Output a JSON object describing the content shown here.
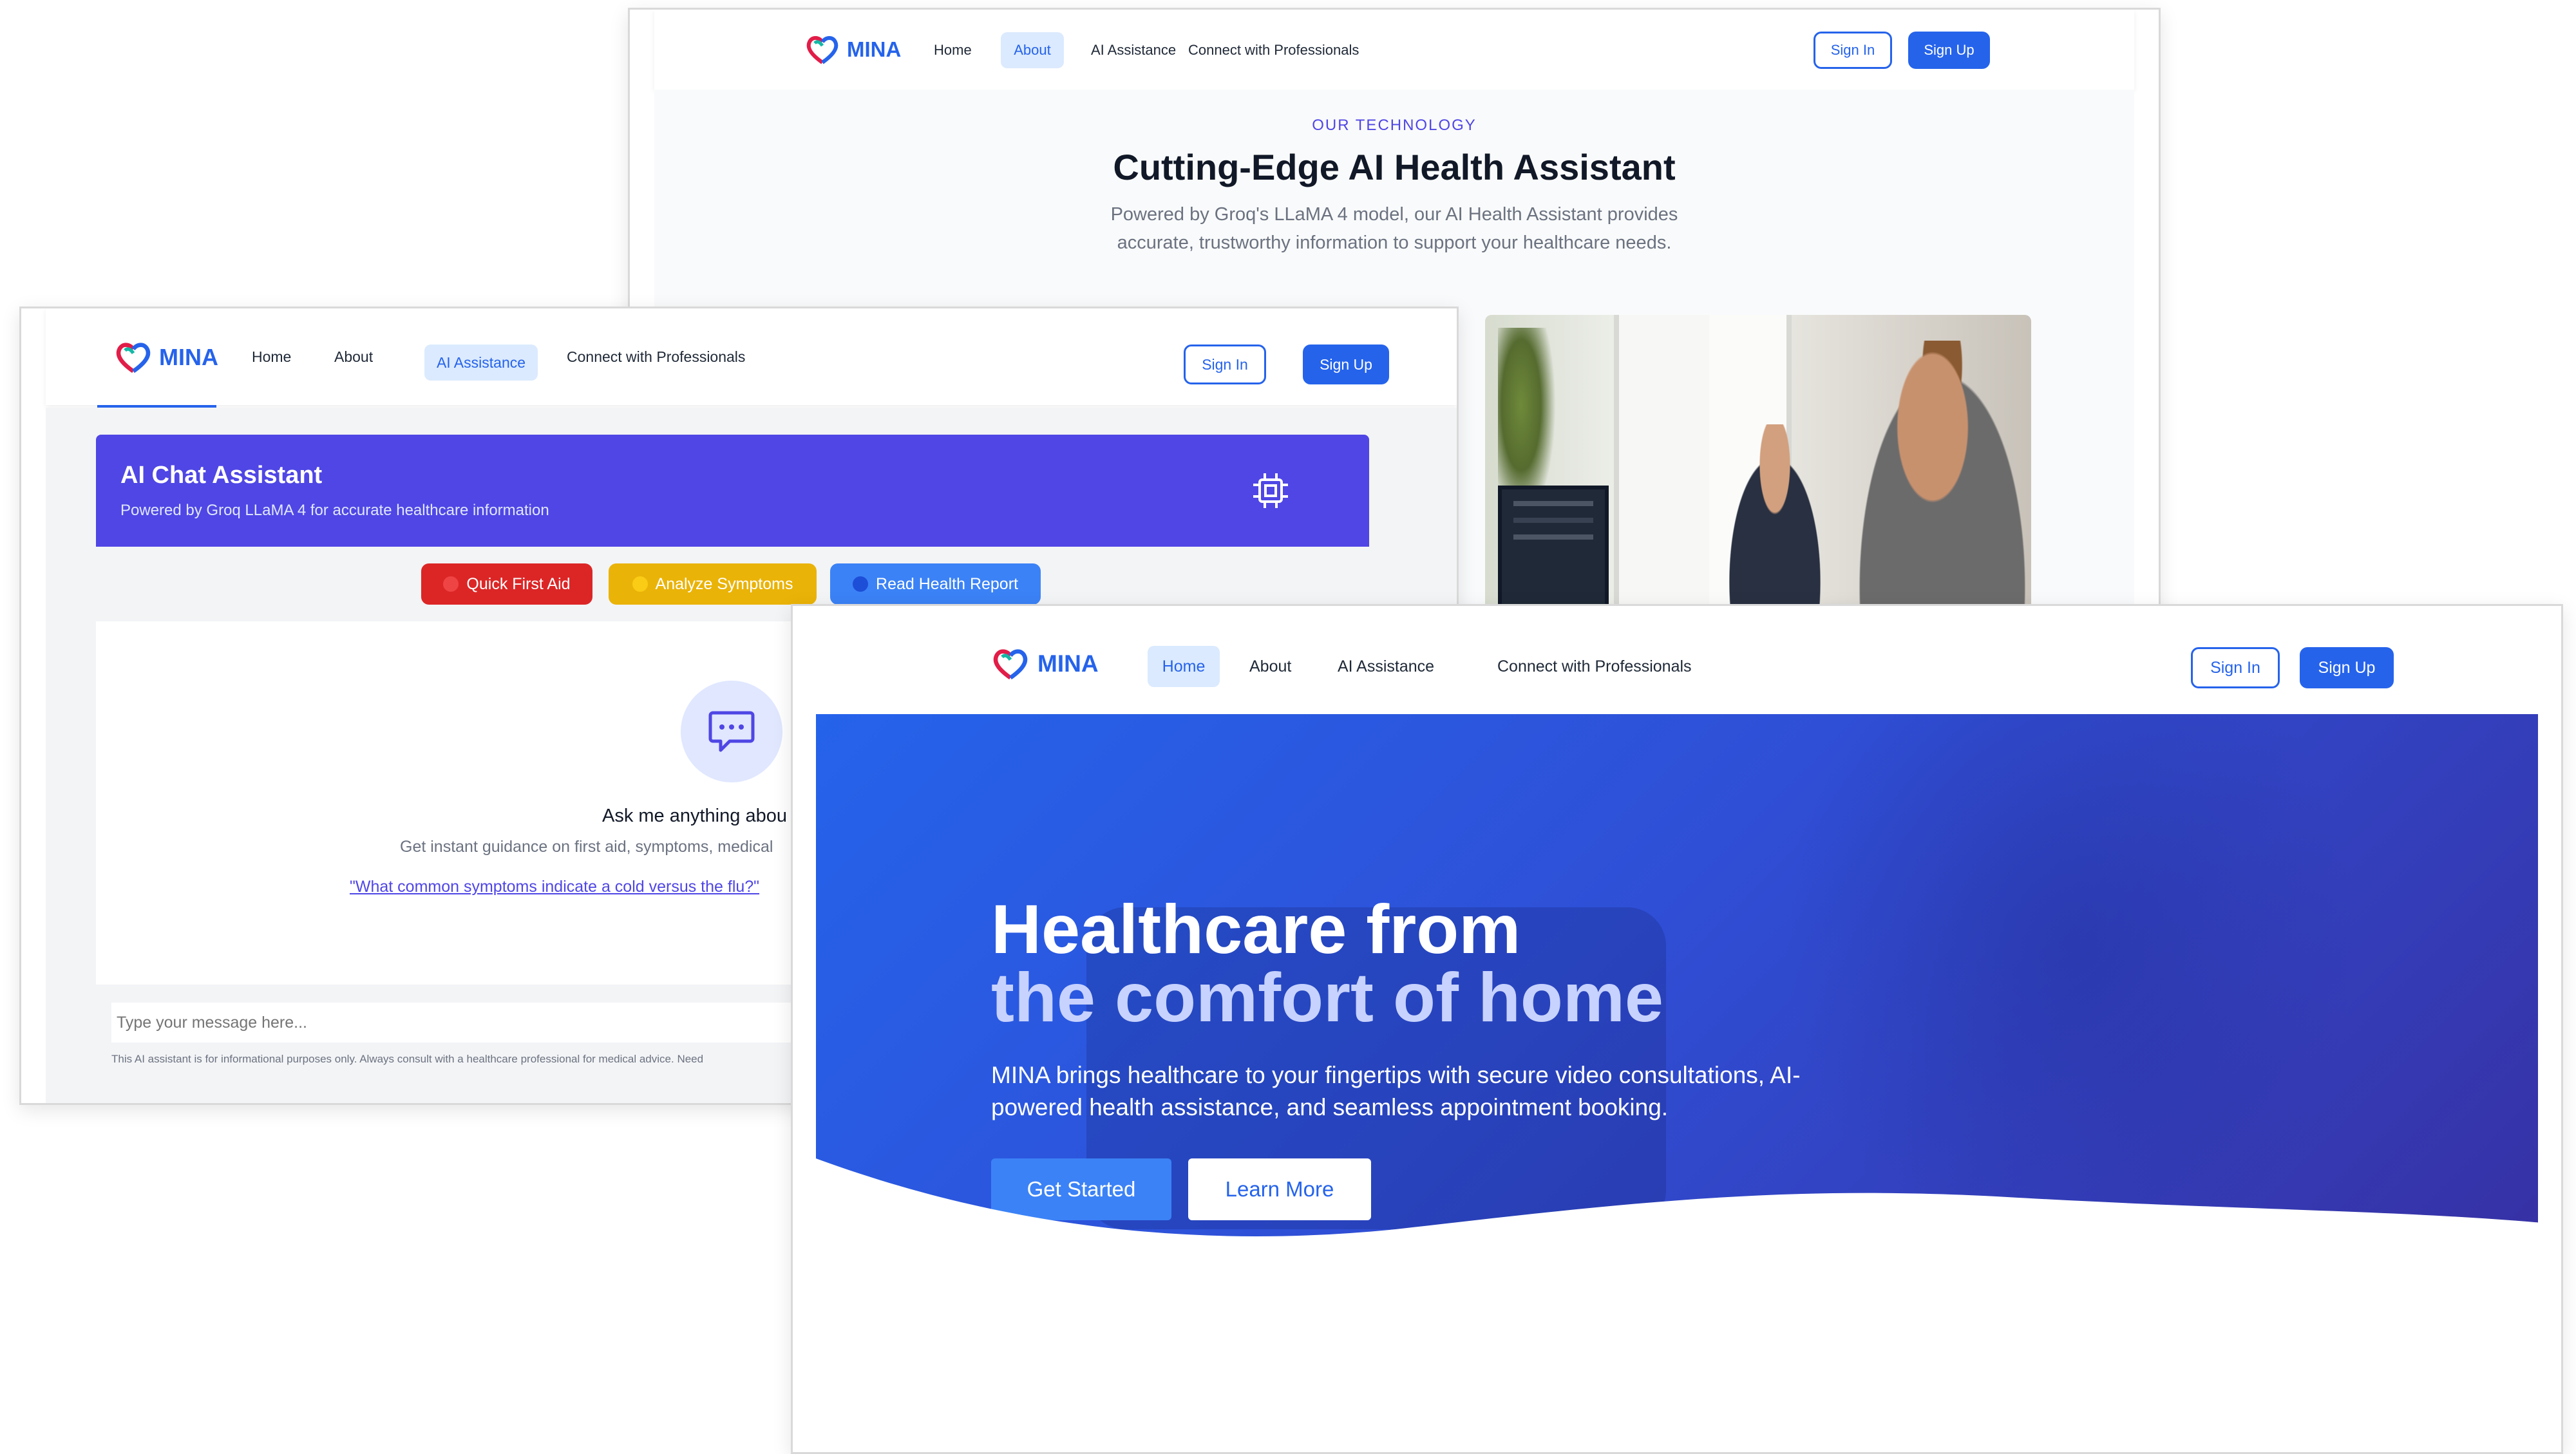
{
  "brand": {
    "name": "MINA"
  },
  "nav": {
    "home": "Home",
    "about": "About",
    "ai": "AI Assistance",
    "connect": "Connect with Professionals",
    "sign_in": "Sign In",
    "sign_up": "Sign Up"
  },
  "about_page": {
    "eyebrow": "OUR TECHNOLOGY",
    "title": "Cutting-Edge AI Health Assistant",
    "description_line1": "Powered by Groq's LLaMA 4 model, our AI Health Assistant provides",
    "description_line2": "accurate, trustworthy information to support your healthcare needs."
  },
  "chat_page": {
    "header_title": "AI Chat Assistant",
    "header_subtitle": "Powered by Groq LLaMA 4 for accurate healthcare information",
    "quick_actions": [
      {
        "label": "Quick First Aid",
        "icon": "red-dot-icon",
        "color": "#dc2626"
      },
      {
        "label": "Analyze Symptoms",
        "icon": "yellow-dot-icon",
        "color": "#eab308"
      },
      {
        "label": "Read Health Report",
        "icon": "blue-dot-icon",
        "color": "#3b82f6"
      }
    ],
    "empty_title": "Ask me anything abou",
    "empty_subtitle": "Get instant guidance on first aid, symptoms, medical",
    "example_question": "\"What common symptoms indicate a cold versus the flu?\"",
    "input_placeholder": "Type your message here...",
    "disclaimer": "This AI assistant is for informational purposes only. Always consult with a healthcare professional for medical advice. Need"
  },
  "home_page": {
    "hero_line1": "Healthcare from",
    "hero_line2": "the comfort of home",
    "hero_desc_line1": "MINA brings healthcare to your fingertips with secure video consultations, AI-",
    "hero_desc_line2": "powered health assistance, and seamless appointment booking.",
    "get_started": "Get Started",
    "learn_more": "Learn More"
  },
  "colors": {
    "primary": "#2563eb",
    "chat_header": "#4f46e5",
    "hero_gradient_start": "#2563eb",
    "hero_gradient_end": "#3730a3"
  }
}
